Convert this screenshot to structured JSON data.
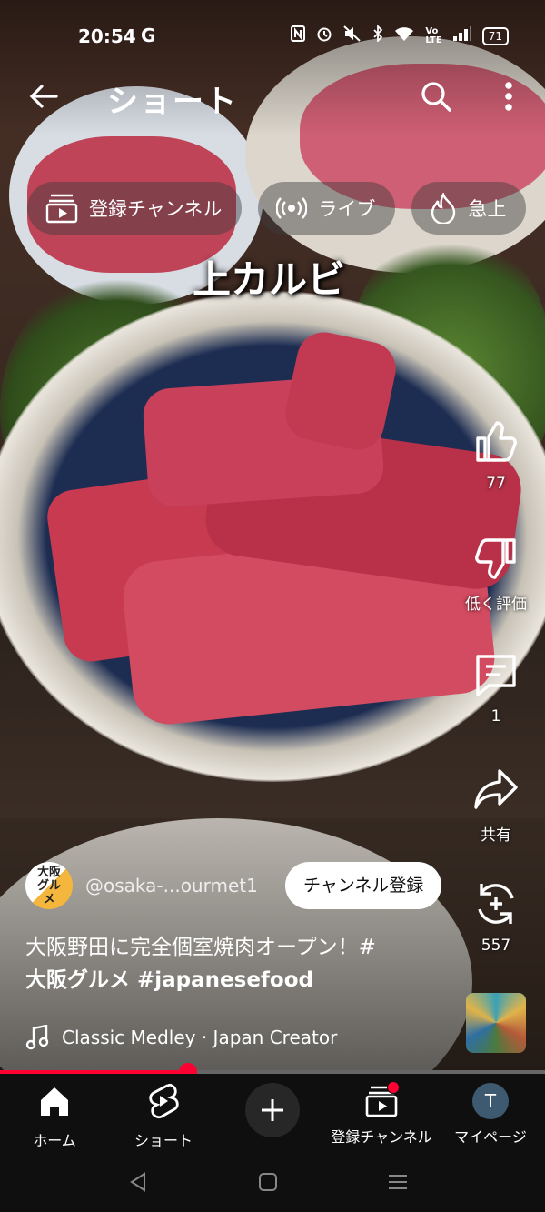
{
  "status_bar": {
    "time": "20:54",
    "app_indicator": "G",
    "battery": "71",
    "icons": [
      "nfc-icon",
      "alarm-icon",
      "mute-icon",
      "bluetooth-icon",
      "wifi-icon",
      "volte-icon",
      "signal-icon",
      "battery-icon"
    ]
  },
  "header": {
    "title": "ショート",
    "back_icon": "arrow-left-icon",
    "search_icon": "search-icon",
    "more_icon": "more-vert-icon"
  },
  "chips": [
    {
      "label": "登録チャンネル",
      "icon": "subscriptions-icon"
    },
    {
      "label": "ライブ",
      "icon": "live-icon"
    },
    {
      "label": "急上",
      "icon": "trending-icon"
    }
  ],
  "video": {
    "caption": "上カルビ"
  },
  "actions": {
    "like_count": "77",
    "dislike_label": "低く評価",
    "comment_count": "1",
    "share_label": "共有",
    "remix_count": "557"
  },
  "channel": {
    "avatar_text": "大阪グルメ",
    "handle": "@osaka-...ourmet1",
    "subscribe_label": "チャンネル登録"
  },
  "description": {
    "text": "大阪野田に完全個室焼肉オープン！#",
    "hashtags": "大阪グルメ #japanesefood"
  },
  "music": {
    "label": "Classic Medley · Japan Creator"
  },
  "progress": {
    "fraction": 0.345
  },
  "bottom_nav": {
    "home": "ホーム",
    "shorts": "ショート",
    "subscriptions": "登録チャンネル",
    "you": "マイページ",
    "user_initial": "T"
  },
  "colors": {
    "accent": "#ff0033",
    "nav_background": "#0f0f0f",
    "user_avatar": "#3d5a70"
  }
}
